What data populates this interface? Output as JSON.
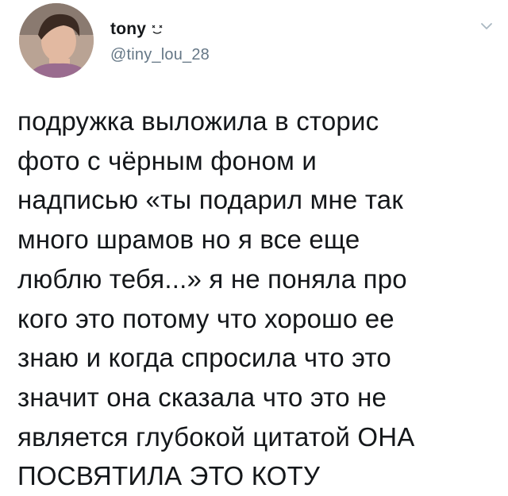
{
  "tweet": {
    "author": {
      "display_name": "tony",
      "handle": "@tiny_lou_28",
      "name_emoji": "face-emoji",
      "avatar": "profile-photo"
    },
    "menu_icon": "chevron-down-icon",
    "text": "подружка выложила в сторис\nфото с чёрным фоном и\nнадписью «ты подарил мне так\nмного шрамов но я все еще\nлюблю тебя...» я не поняла про\nкого это потому что хорошо ее\nзнаю и когда спросила что это\nзначит она сказала что это не\nявляется глубокой цитатой ОНА\nПОСВЯТИЛА ЭТО КОТУ"
  }
}
